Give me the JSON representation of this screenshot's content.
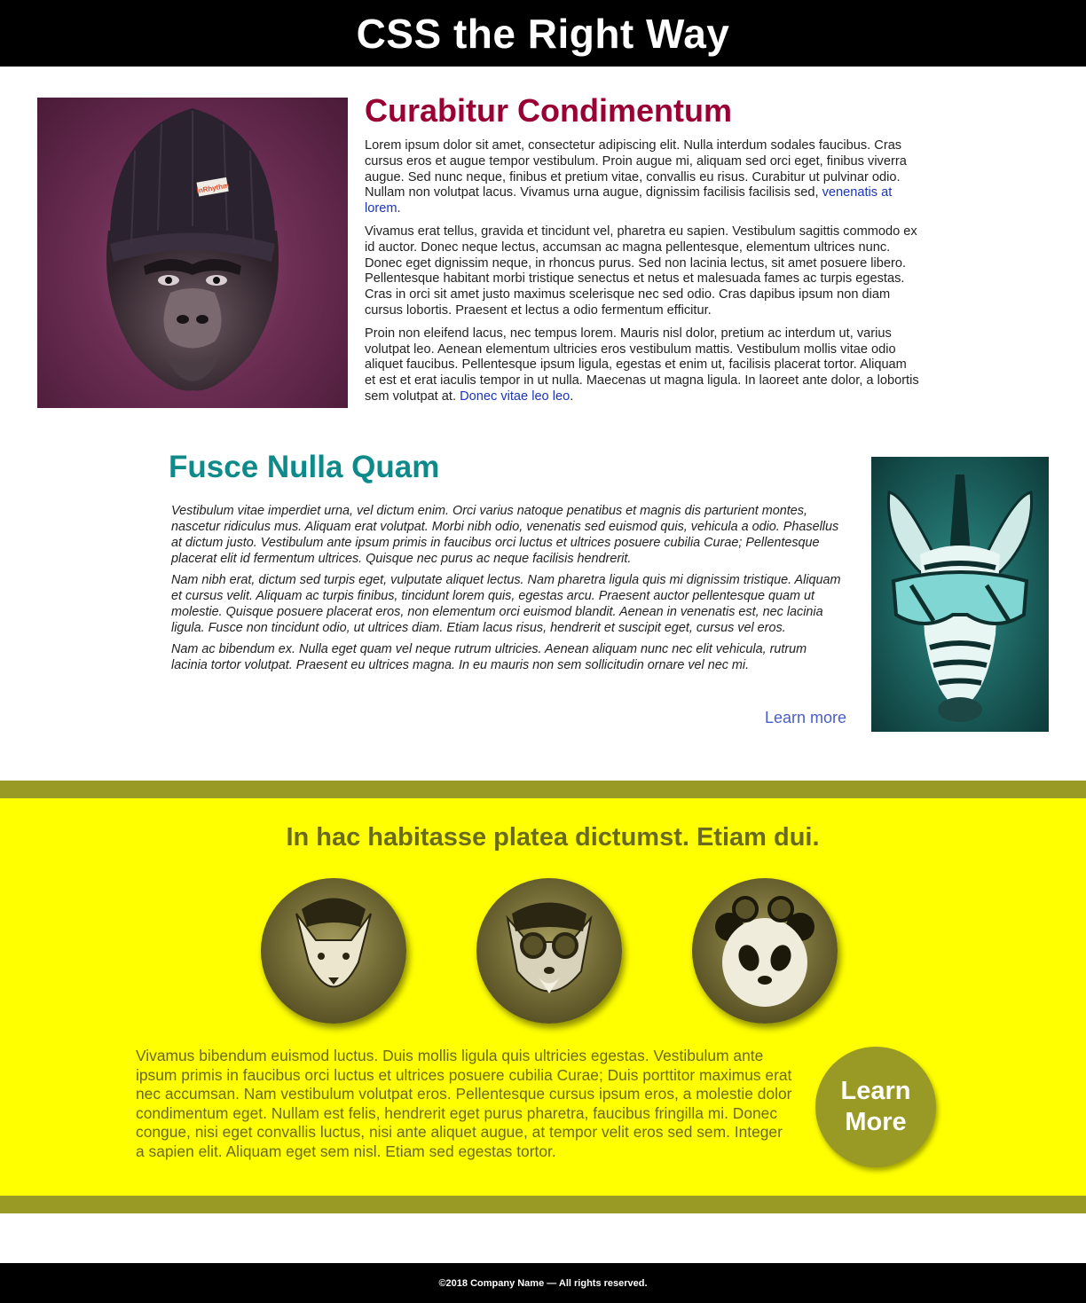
{
  "header": {
    "title": "CSS the Right Way"
  },
  "section1": {
    "heading": "Curabitur Condimentum",
    "image_icon": "gorilla-illustration",
    "hat_tag": "InRhythm",
    "p1_text": "Lorem ipsum dolor sit amet, consectetur adipiscing elit. Nulla interdum sodales faucibus. Cras cursus eros et augue tempor vestibulum. Proin augue mi, aliquam sed orci eget, finibus viverra augue. Sed nunc neque, finibus et pretium vitae, convallis eu risus. Curabitur ut pulvinar odio. Nullam non volutpat lacus. Vivamus urna augue, dignissim facilisis facilisis sed, ",
    "p1_link": "venenatis at lorem",
    "p2_text": "Vivamus erat tellus, gravida et tincidunt vel, pharetra eu sapien. Vestibulum sagittis commodo ex id auctor. Donec neque lectus, accumsan ac magna pellentesque, elementum ultrices nunc. Donec eget dignissim neque, in rhoncus purus. Sed non lacinia lectus, sit amet posuere libero. Pellentesque habitant morbi tristique senectus et netus et malesuada fames ac turpis egestas. Cras in orci sit amet justo maximus scelerisque nec sed odio. Cras dapibus ipsum non diam cursus lobortis. Praesent et lectus a odio fermentum efficitur.",
    "p3_text": "Proin non eleifend lacus, nec tempus lorem. Mauris nisl dolor, pretium ac interdum ut, varius volutpat leo. Aenean elementum ultricies eros vestibulum mattis. Vestibulum mollis vitae odio aliquet faucibus. Pellentesque ipsum ligula, egestas et enim ut, facilisis placerat tortor. Aliquam et est et erat iaculis tempor in ut nulla. Maecenas ut magna ligula. In laoreet ante dolor, a lobortis sem volutpat at. ",
    "p3_link": "Donec vitae leo leo",
    "period": "."
  },
  "section2": {
    "heading": "Fusce Nulla Quam",
    "image_icon": "zebra-illustration",
    "p1": "Vestibulum vitae imperdiet urna, vel dictum enim. Orci varius natoque penatibus et magnis dis parturient montes, nascetur ridiculus mus. Aliquam erat volutpat. Morbi nibh odio, venenatis sed euismod quis, vehicula a odio. Phasellus at dictum justo. Vestibulum ante ipsum primis in faucibus orci luctus et ultrices posuere cubilia Curae; Pellentesque placerat elit id fermentum ultrices. Quisque nec purus ac neque facilisis hendrerit.",
    "p2": "Nam nibh erat, dictum sed turpis eget, vulputate aliquet lectus. Nam pharetra ligula quis mi dignissim tristique. Aliquam et cursus velit. Aliquam ac turpis finibus, tincidunt lorem quis, egestas arcu. Praesent auctor pellentesque quam ut molestie. Quisque posuere placerat eros, non elementum orci euismod blandit. Aenean in venenatis est, nec lacinia ligula. Fusce non tincidunt odio, ut ultrices diam. Etiam lacus risus, hendrerit et suscipit eget, cursus vel eros.",
    "p3": "Nam ac bibendum ex. Nulla eget quam vel neque rutrum ultricies. Aenean aliquam nunc nec elit vehicula, rutrum lacinia tortor volutpat. Praesent eu ultrices magna. In eu mauris non sem sollicitudin ornare vel nec mi.",
    "link": "Learn more"
  },
  "band": {
    "heading": "In hac habitasse platea dictumst. Etiam dui.",
    "circles": [
      "fox-illustration",
      "wolf-illustration",
      "panda-illustration"
    ],
    "body": "Vivamus bibendum euismod luctus. Duis mollis ligula quis ultricies egestas. Vestibulum ante ipsum primis in faucibus orci luctus et ultrices posuere cubilia Curae; Duis porttitor maximus erat nec accumsan. Nam vestibulum volutpat eros. Pellentesque cursus ipsum eros, a molestie dolor condimentum eget. Nullam est felis, hendrerit eget purus pharetra, faucibus fringilla mi. Donec congue, nisi eget convallis luctus, nisi ante aliquet augue, at tempor velit eros sed sem. Integer a sapien elit. Aliquam eget sem nisl. Etiam sed egestas tortor.",
    "button": "Learn More"
  },
  "footer": {
    "text": "©2018 Company Name — All rights reserved."
  },
  "colors": {
    "header_bg": "#000000",
    "section1_heading": "#990033",
    "section2_heading": "#0f8a8a",
    "link": "#1a35b8",
    "band_bg": "#ffff00",
    "band_accent": "#999926",
    "band_text": "#6a6a1f"
  }
}
